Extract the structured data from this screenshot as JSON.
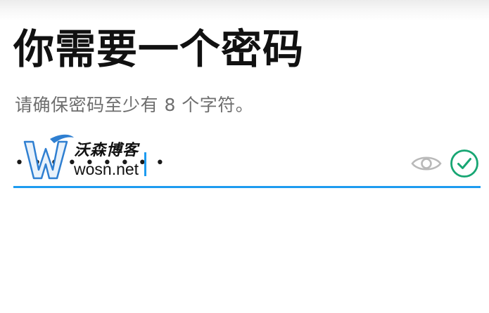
{
  "title": "你需要一个密码",
  "subtitle": "请确保密码至少有 8 个字符。",
  "password_field": {
    "value": "•••••••••",
    "visibility_icon": "eye-icon",
    "status_icon": "check-circle-icon",
    "accent_color": "#1d9bf0",
    "valid_color": "#17a673"
  },
  "watermark": {
    "brand": "沃森博客",
    "domain": "wosn.net"
  }
}
